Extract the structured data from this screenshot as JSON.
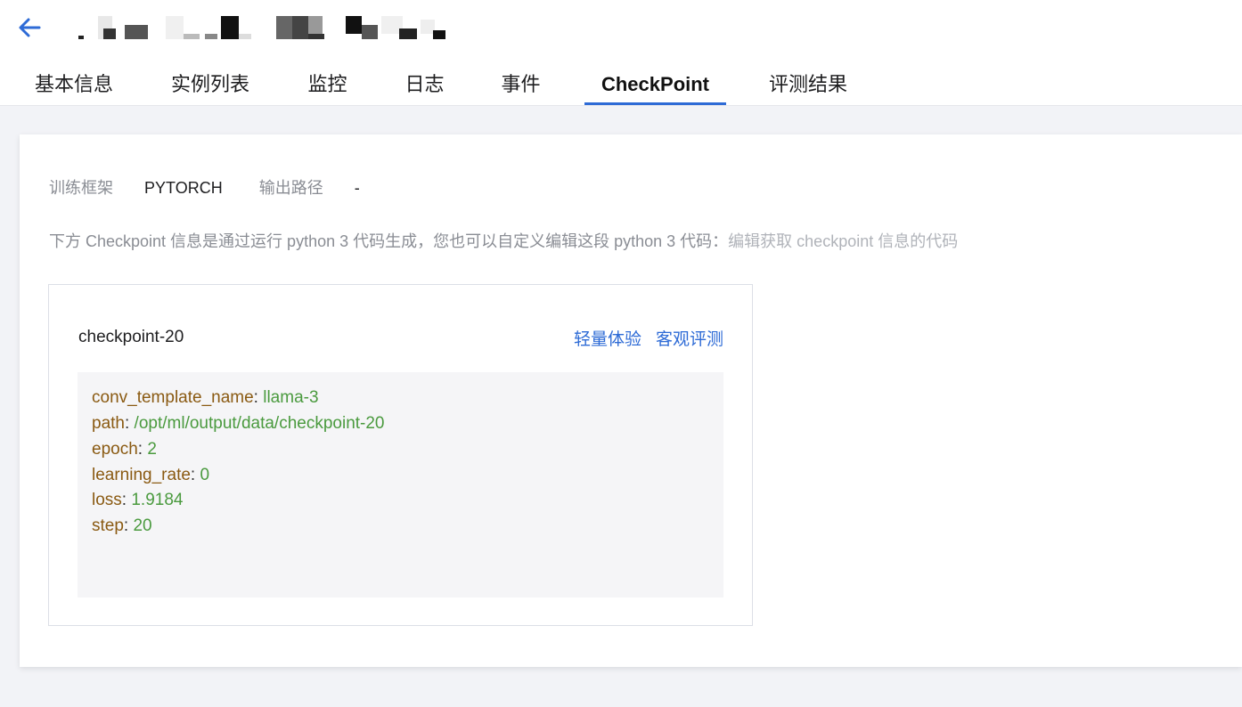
{
  "header": {
    "tabs": [
      {
        "label": "基本信息"
      },
      {
        "label": "实例列表"
      },
      {
        "label": "监控"
      },
      {
        "label": "日志"
      },
      {
        "label": "事件"
      },
      {
        "label": "CheckPoint",
        "active": true
      },
      {
        "label": "评测结果"
      }
    ]
  },
  "meta": {
    "framework_label": "训练框架",
    "framework_value": "PYTORCH",
    "output_label": "输出路径",
    "output_value": "-"
  },
  "hint": {
    "text": "下方 Checkpoint 信息是通过运行 python 3 代码生成，您也可以自定义编辑这段 python 3 代码：",
    "link": "编辑获取 checkpoint 信息的代码"
  },
  "checkpoint": {
    "name": "checkpoint-20",
    "actions": [
      "轻量体验",
      "客观评测"
    ],
    "fields": [
      {
        "key": "conv_template_name",
        "value": "llama-3"
      },
      {
        "key": "path",
        "value": "/opt/ml/output/data/checkpoint-20"
      },
      {
        "key": "epoch",
        "value": "2"
      },
      {
        "key": "learning_rate",
        "value": "0"
      },
      {
        "key": "loss",
        "value": "1.9184"
      },
      {
        "key": "step",
        "value": "20"
      }
    ]
  },
  "colors": {
    "accent": "#2e6bd6",
    "key": "#8a5a12",
    "value": "#4a9a3e"
  }
}
